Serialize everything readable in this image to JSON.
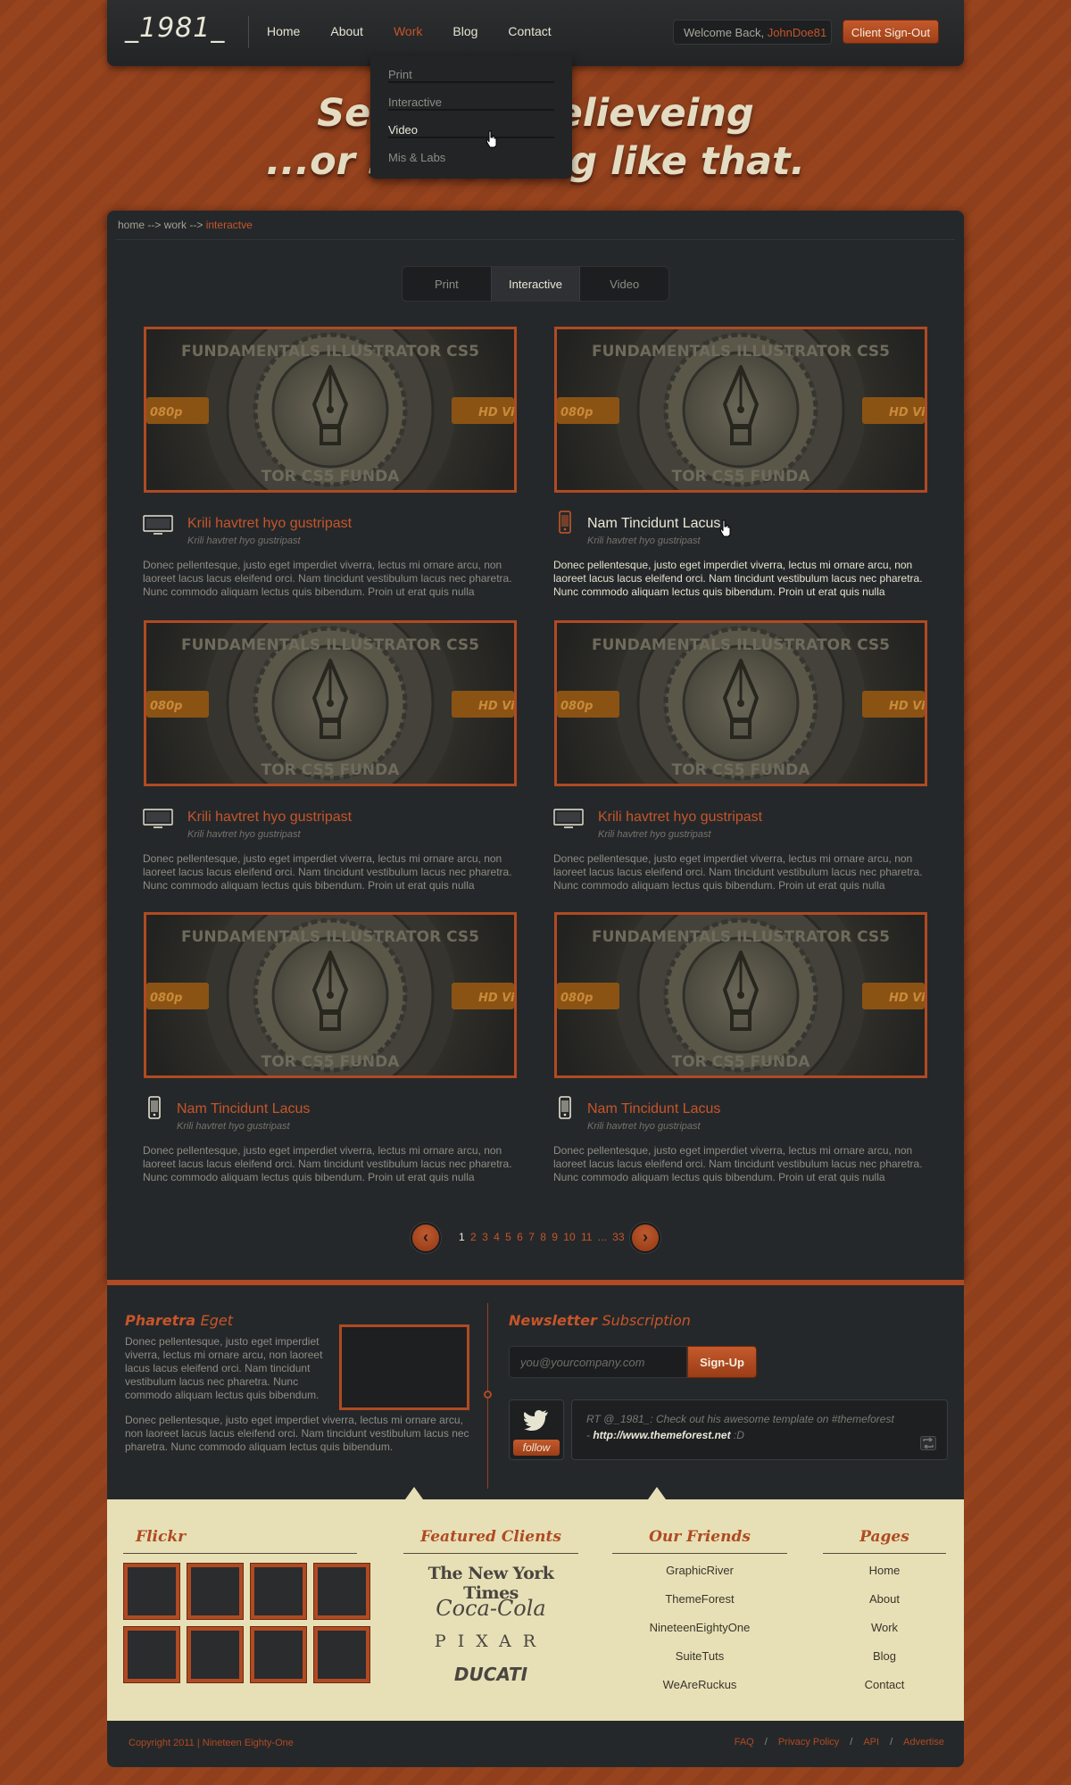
{
  "header": {
    "logo": "_1981_",
    "nav": [
      "Home",
      "About",
      "Work",
      "Blog",
      "Contact"
    ],
    "welcome_prefix": "Welcome Back, ",
    "welcome_user": "JohnDoe81",
    "signout": "Client Sign-Out"
  },
  "dropdown": {
    "items": [
      "Print",
      "Interactive",
      "Video",
      "Mis & Labs"
    ]
  },
  "hero": {
    "line1": "Seeing is Believeing",
    "line2": "...or something like that."
  },
  "breadcrumb": {
    "home": "home",
    "sep1": " --> ",
    "work": "work",
    "sep2": " --> ",
    "current": "interactve"
  },
  "tabs": [
    "Print",
    "Interactive",
    "Video"
  ],
  "thumb_text": {
    "left_ribbon": "080p",
    "right_ribbon": "HD Vi",
    "ring_top": "FUNDAMENTALS ILLUSTRATOR CS5",
    "ring_bottom": "TOR CS5 FUNDA"
  },
  "cards": [
    {
      "title": "Krili havtret hyo gustripast",
      "sub": "Krili havtret hyo gustripast",
      "desc": "Donec pellentesque, justo eget imperdiet viverra, lectus mi ornare arcu, non laoreet lacus lacus eleifend orci. Nam tincidunt vestibulum lacus nec pharetra. Nunc commodo aliquam lectus quis bibendum. Proin ut erat quis nulla",
      "icon": "monitor-icon"
    },
    {
      "title": "Nam Tincidunt Lacus",
      "sub": "Krili havtret hyo gustripast",
      "desc": "Donec pellentesque, justo eget imperdiet viverra, lectus mi ornare arcu, non laoreet lacus lacus eleifend orci. Nam tincidunt vestibulum lacus nec pharetra. Nunc commodo aliquam lectus quis bibendum. Proin ut erat quis nulla",
      "icon": "phone-icon"
    },
    {
      "title": "Krili havtret hyo gustripast",
      "sub": "Krili havtret hyo gustripast",
      "desc": "Donec pellentesque, justo eget imperdiet viverra, lectus mi ornare arcu, non laoreet lacus lacus eleifend orci. Nam tincidunt vestibulum lacus nec pharetra. Nunc commodo aliquam lectus quis bibendum. Proin ut erat quis nulla",
      "icon": "monitor-icon"
    },
    {
      "title": "Krili havtret hyo gustripast",
      "sub": "Krili havtret hyo gustripast",
      "desc": "Donec pellentesque, justo eget imperdiet viverra, lectus mi ornare arcu, non laoreet lacus lacus eleifend orci. Nam tincidunt vestibulum lacus nec pharetra. Nunc commodo aliquam lectus quis bibendum. Proin ut erat quis nulla",
      "icon": "monitor-icon"
    },
    {
      "title": "Nam Tincidunt Lacus",
      "sub": "Krili havtret hyo gustripast",
      "desc": "Donec pellentesque, justo eget imperdiet viverra, lectus mi ornare arcu, non laoreet lacus lacus eleifend orci. Nam tincidunt vestibulum lacus nec pharetra. Nunc commodo aliquam lectus quis bibendum. Proin ut erat quis nulla",
      "icon": "phone-icon"
    },
    {
      "title": "Nam Tincidunt Lacus",
      "sub": "Krili havtret hyo gustripast",
      "desc": "Donec pellentesque, justo eget imperdiet viverra, lectus mi ornare arcu, non laoreet lacus lacus eleifend orci. Nam tincidunt vestibulum lacus nec pharetra. Nunc commodo aliquam lectus quis bibendum. Proin ut erat quis nulla",
      "icon": "phone-icon"
    }
  ],
  "pager": {
    "prev": "‹",
    "next": "›",
    "pages": [
      "1",
      "2",
      "3",
      "4",
      "5",
      "6",
      "7",
      "8",
      "9",
      "10",
      "11",
      "...",
      "33"
    ]
  },
  "pharetra": {
    "title_bold": "Pharetra",
    "title_light": "Eget",
    "p1": "Donec pellentesque, justo eget imperdiet viverra, lectus mi ornare arcu, non laoreet lacus lacus eleifend orci. Nam tincidunt vestibulum lacus nec pharetra. Nunc commodo aliquam lectus quis bibendum.",
    "p2": "Donec pellentesque, justo eget imperdiet viverra, lectus mi ornare arcu, non laoreet lacus lacus eleifend orci. Nam tincidunt vestibulum lacus nec pharetra. Nunc commodo aliquam lectus quis bibendum."
  },
  "newsletter": {
    "title_bold": "Newsletter",
    "title_light": "Subscription",
    "placeholder": "you@yourcompany.com",
    "button": "Sign-Up"
  },
  "twitter": {
    "follow": "follow",
    "tweet_text": "RT @_1981_: Check out his awesome template on #themeforest",
    "tweet_prefix": " - ",
    "tweet_link": "http://www.themeforest.net",
    "tweet_suffix": " :D"
  },
  "footer": {
    "flickr_title": "Flickr",
    "clients_title": "Featured Clients",
    "clients": [
      "The New York Times",
      "Coca-Cola",
      "PIXAR",
      "DUCATI"
    ],
    "friends_title": "Our Friends",
    "friends": [
      "GraphicRiver",
      "ThemeForest",
      "NineteenEightyOne",
      "SuiteTuts",
      "WeAreRuckus"
    ],
    "pages_title": "Pages",
    "pages": [
      "Home",
      "About",
      "Work",
      "Blog",
      "Contact"
    ]
  },
  "bottom": {
    "copyright": "Copyright 2011 | Nineteen Eighty-One",
    "links": [
      "FAQ",
      "Privacy Policy",
      "API",
      "Advertise"
    ],
    "separator": "/"
  },
  "colors": {
    "accent": "#c5552a",
    "dark_panel": "#25282a",
    "cream": "#e7e0b6",
    "background": "#8f3f1c"
  }
}
